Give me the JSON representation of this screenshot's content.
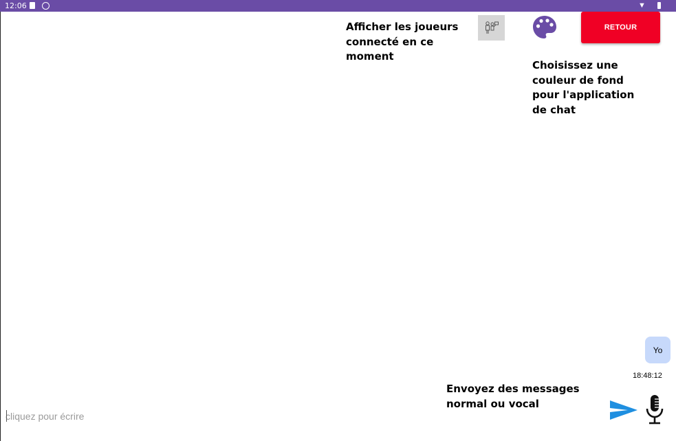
{
  "status_bar": {
    "time": "12:06"
  },
  "header": {
    "players_label": "Afficher les joueurs connecté en ce moment",
    "color_label": "Choisissez une couleur de fond pour l'application de chat",
    "back_button": "RETOUR"
  },
  "colors": {
    "accent": "#6a4ca6",
    "back_button": "#f00025",
    "send": "#1f8fe0",
    "bubble": "#c7d9fb"
  },
  "icons": [
    "players-icon",
    "palette-icon",
    "send-icon",
    "mic-icon"
  ],
  "messages": [
    {
      "text": "Yo",
      "time": "18:48:12"
    }
  ],
  "composer": {
    "hint_label": "Envoyez des messages normal ou vocal",
    "placeholder": "cliquez pour écrire",
    "value": ""
  }
}
